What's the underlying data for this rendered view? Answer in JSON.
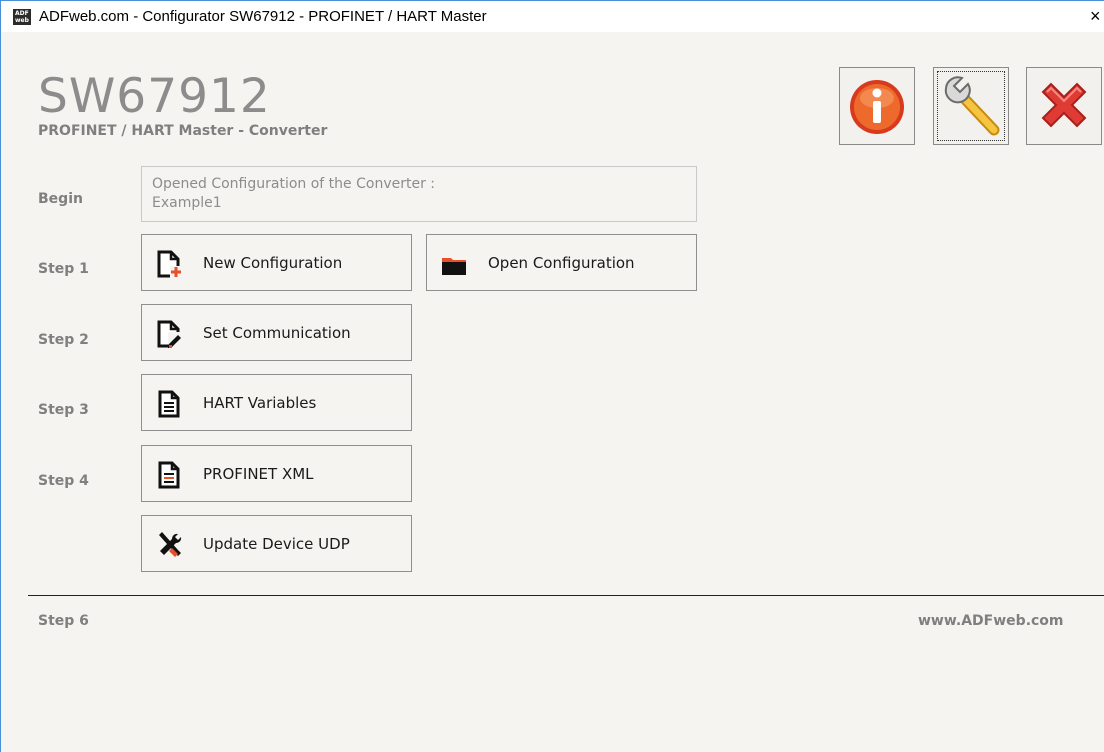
{
  "window": {
    "title": "ADFweb.com - Configurator SW67912 - PROFINET / HART Master",
    "app_icon_text": [
      "ADF",
      "web"
    ],
    "close_glyph": "×"
  },
  "header": {
    "product_code": "SW67912",
    "subtitle": "PROFINET / HART Master - Converter"
  },
  "toolbar": {
    "info_icon": "info-icon",
    "settings_icon": "wrench-icon",
    "exit_icon": "red-x-icon"
  },
  "steps": {
    "begin_label": "Begin",
    "begin_text_line1": "Opened Configuration of the Converter :",
    "begin_text_line2": "Example1",
    "step1_label": "Step 1",
    "step2_label": "Step 2",
    "step3_label": "Step 3",
    "step4_label": "Step 4",
    "step6_label": "Step 6"
  },
  "buttons": {
    "new_config": "New Configuration",
    "open_config": "Open Configuration",
    "set_comm": "Set Communication",
    "hart_vars": "HART Variables",
    "profinet_xml": "PROFINET XML",
    "update_device": "Update Device UDP"
  },
  "footer": {
    "website": "www.ADFweb.com"
  },
  "colors": {
    "background": "#f5f4f1",
    "label_gray": "#7f7f7f",
    "accent_orange": "#e8502a",
    "info_red": "#e8402a",
    "wrench_yellow": "#f2b830"
  }
}
